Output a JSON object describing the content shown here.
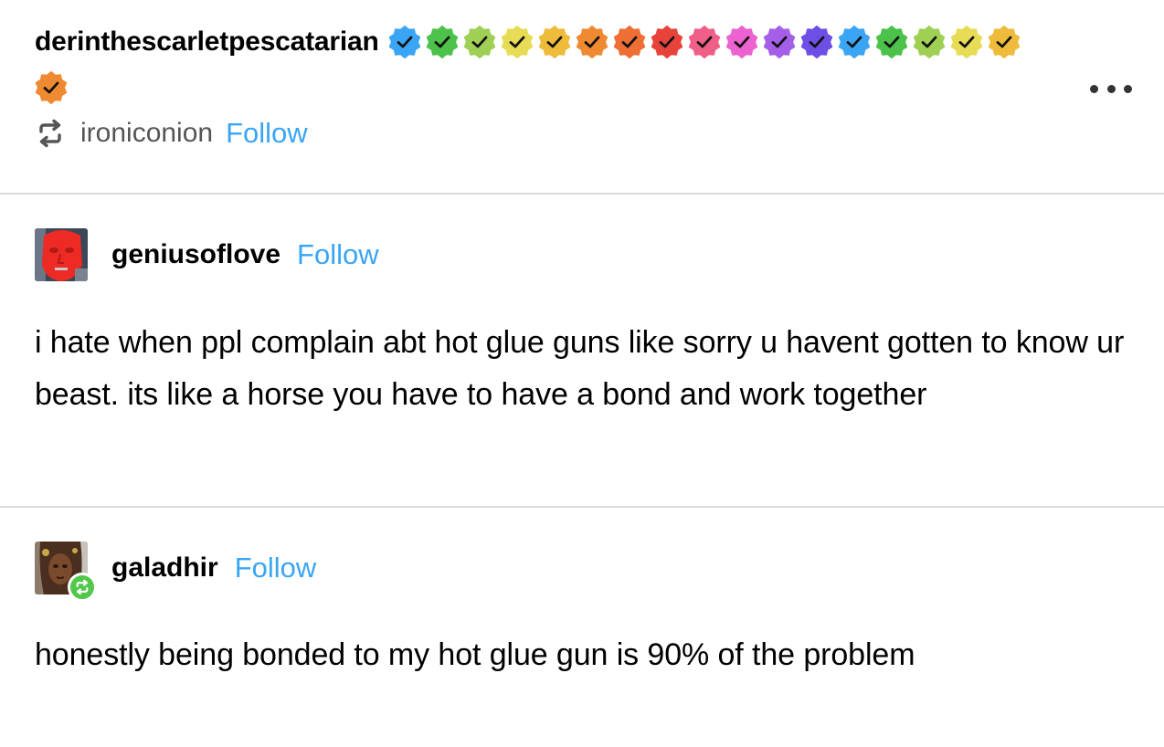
{
  "header": {
    "username": "derinthescarletpescatarian",
    "badges": [
      {
        "icon": "verified-badge-icon",
        "color": "#3aa5f5"
      },
      {
        "icon": "verified-badge-icon",
        "color": "#4cc24a"
      },
      {
        "icon": "verified-badge-icon",
        "color": "#9fd055"
      },
      {
        "icon": "verified-badge-icon",
        "color": "#e6dc55"
      },
      {
        "icon": "verified-badge-icon",
        "color": "#eebb3a"
      },
      {
        "icon": "verified-badge-icon",
        "color": "#ef8a32"
      },
      {
        "icon": "verified-badge-icon",
        "color": "#ee6e35"
      },
      {
        "icon": "verified-badge-icon",
        "color": "#e8433a"
      },
      {
        "icon": "verified-badge-icon",
        "color": "#ef5f87"
      },
      {
        "icon": "verified-badge-icon",
        "color": "#ec63cf"
      },
      {
        "icon": "verified-badge-icon",
        "color": "#a55ee8"
      },
      {
        "icon": "verified-badge-icon",
        "color": "#6d4fe6"
      },
      {
        "icon": "verified-badge-icon",
        "color": "#3aa5f5"
      },
      {
        "icon": "verified-badge-icon",
        "color": "#4cc24a"
      },
      {
        "icon": "verified-badge-icon",
        "color": "#9fd055"
      },
      {
        "icon": "verified-badge-icon",
        "color": "#e6dc55"
      },
      {
        "icon": "verified-badge-icon",
        "color": "#eebb3a"
      },
      {
        "icon": "verified-badge-icon",
        "color": "#ef8a32"
      }
    ],
    "reblogged_from": "ironiconion",
    "follow_label": "Follow"
  },
  "posts": [
    {
      "username": "geniusoflove",
      "follow_label": "Follow",
      "text": "i hate when ppl complain abt hot glue guns like sorry u havent gotten to know ur beast. its like a horse you have to have a bond and work together"
    },
    {
      "username": "galadhir",
      "follow_label": "Follow",
      "text": "honestly being bonded to my hot glue gun is 90% of the problem"
    }
  ],
  "colors": {
    "accent": "#3aa5f5",
    "reblog_badge": "#52c84a",
    "divider": "#dcdcdc"
  }
}
